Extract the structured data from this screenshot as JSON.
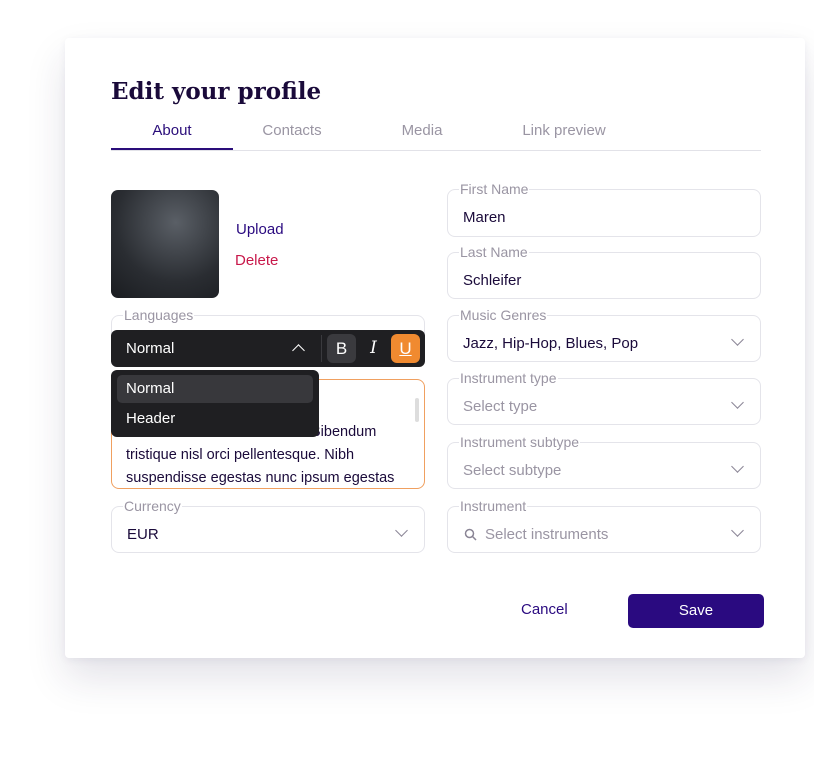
{
  "title": "Edit your profile",
  "tabs": [
    {
      "label": "About",
      "active": true
    },
    {
      "label": "Contacts"
    },
    {
      "label": "Media"
    },
    {
      "label": "Link preview"
    }
  ],
  "photo": {
    "upload": "Upload",
    "delete": "Delete"
  },
  "fields": {
    "first_name": {
      "label": "First Name",
      "value": "Maren"
    },
    "last_name": {
      "label": "Last Name",
      "value": "Schleifer"
    },
    "music_genres": {
      "label": "Music Genres",
      "value": "Jazz, Hip-Hop, Blues, Pop"
    },
    "instrument_type": {
      "label": "Instrument type",
      "placeholder": "Select type"
    },
    "instrument_subtype": {
      "label": "Instrument subtype",
      "placeholder": "Select subtype"
    },
    "instrument": {
      "label": "Instrument",
      "placeholder": "Select instruments"
    },
    "languages": {
      "label": "Languages"
    },
    "currency": {
      "label": "Currency",
      "value": "EUR"
    }
  },
  "editor": {
    "format_selected": "Normal",
    "format_options": [
      "Normal",
      "Header"
    ],
    "bold": "B",
    "italic": "I",
    "underline": "U",
    "text_visible": "Bibendum tristique nisl orci pellentesque. Nibh suspendisse egestas nunc ipsum egestas",
    "underline_active_color": "#f08a30"
  },
  "actions": {
    "cancel": "Cancel",
    "save": "Save"
  },
  "colors": {
    "primary": "#2a0a80",
    "danger": "#c8184a",
    "accent": "#f08a30"
  }
}
